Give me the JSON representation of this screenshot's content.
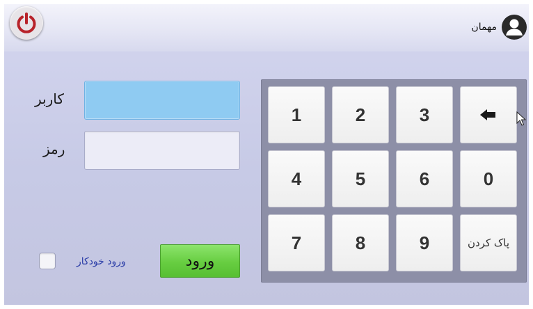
{
  "header": {
    "power_icon": "power-icon",
    "user_icon": "user-avatar-icon",
    "user_name": "مهمان"
  },
  "form": {
    "username_label": "کاربر",
    "username_value": "",
    "password_label": "رمز",
    "password_value": "",
    "auto_login_label": "ورود خودکار",
    "auto_login_checked": false,
    "login_button": "ورود"
  },
  "keypad": {
    "rows": [
      [
        "1",
        "2",
        "3",
        "⬅"
      ],
      [
        "4",
        "5",
        "6",
        "0"
      ],
      [
        "7",
        "8",
        "9",
        "پاک کردن"
      ]
    ],
    "backspace_icon": "backspace-arrow-icon"
  },
  "colors": {
    "power_red": "#b8232a",
    "login_green": "#67cd41",
    "active_input": "#8fcbf2",
    "keypad_bg": "#8d8fa7"
  }
}
